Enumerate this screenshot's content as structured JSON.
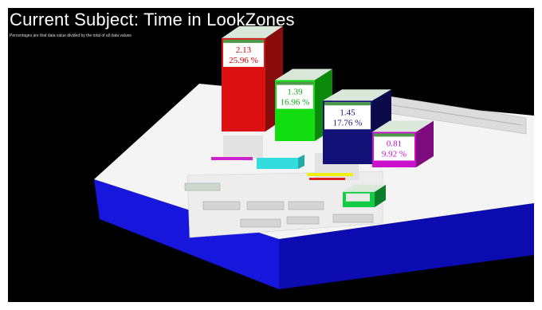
{
  "title": "Current Subject: Time in LookZones",
  "subtitle": "Percentages are that data value divided by the total of all data values",
  "chart_data": {
    "type": "bar",
    "style": "3d",
    "series": [
      {
        "name": "",
        "value": 2.13,
        "percent": 25.96,
        "value_label": "2.13",
        "percent_label": "25.96 %",
        "color": "#dd1111",
        "text_color": "#cc0000"
      },
      {
        "name": "",
        "value": 1.39,
        "percent": 16.96,
        "value_label": "1.39",
        "percent_label": "16.96 %",
        "color": "#11dd11",
        "text_color": "#11aa11"
      },
      {
        "name": "",
        "value": 1.45,
        "percent": 17.76,
        "value_label": "1.45",
        "percent_label": "17.76 %",
        "color": "#111177",
        "text_color": "#111177"
      },
      {
        "name": "",
        "value": 0.81,
        "percent": 9.92,
        "value_label": "0.81",
        "percent_label": "9.92 %",
        "color": "#cc11cc",
        "text_color": "#cc11cc"
      },
      {
        "name": "",
        "value": 0.35,
        "percent": 4.3,
        "value_label": "",
        "percent_label": "",
        "color": "#11cc44",
        "text_color": "#11aa33"
      }
    ],
    "base_color": "#2222ee",
    "platform_color": "#f4f4f4",
    "background": "#000000"
  }
}
